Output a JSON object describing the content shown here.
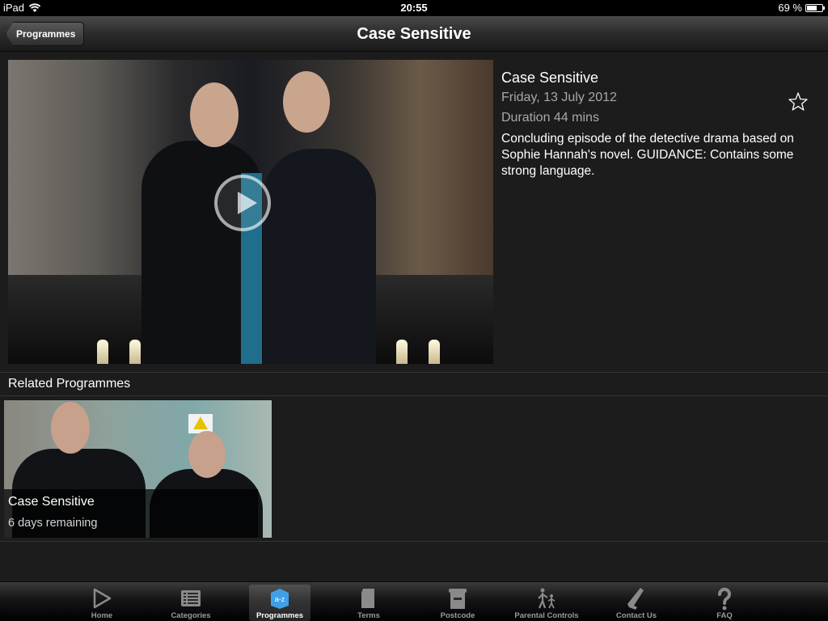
{
  "status_bar": {
    "device": "iPad",
    "time": "20:55",
    "battery": "69 %",
    "battery_level": 0.69
  },
  "nav": {
    "back_label": "Programmes",
    "title": "Case Sensitive"
  },
  "programme": {
    "title": "Case Sensitive",
    "date": "Friday, 13 July 2012",
    "duration": "Duration 44 mins",
    "description": "Concluding episode of the detective drama based on Sophie Hannah's novel. GUIDANCE: Contains some strong language."
  },
  "related": {
    "heading": "Related Programmes",
    "items": [
      {
        "title": "Case Sensitive",
        "subtitle": "6 days remaining"
      }
    ]
  },
  "tabs": [
    {
      "label": "Home",
      "icon": "play-icon",
      "selected": false
    },
    {
      "label": "Categories",
      "icon": "list-icon",
      "selected": false
    },
    {
      "label": "Programmes",
      "icon": "a-z-icon",
      "selected": true
    },
    {
      "label": "Terms",
      "icon": "document-icon",
      "selected": false
    },
    {
      "label": "Postcode",
      "icon": "postbox-icon",
      "selected": false
    },
    {
      "label": "Parental Controls",
      "icon": "family-icon",
      "selected": false
    },
    {
      "label": "Contact Us",
      "icon": "phone-icon",
      "selected": false
    },
    {
      "label": "FAQ",
      "icon": "question-icon",
      "selected": false
    }
  ],
  "colors": {
    "background": "#1c1c1c",
    "selected_tab_icon": "#3fa0e8",
    "tab_icon": "#8a8a8a"
  }
}
